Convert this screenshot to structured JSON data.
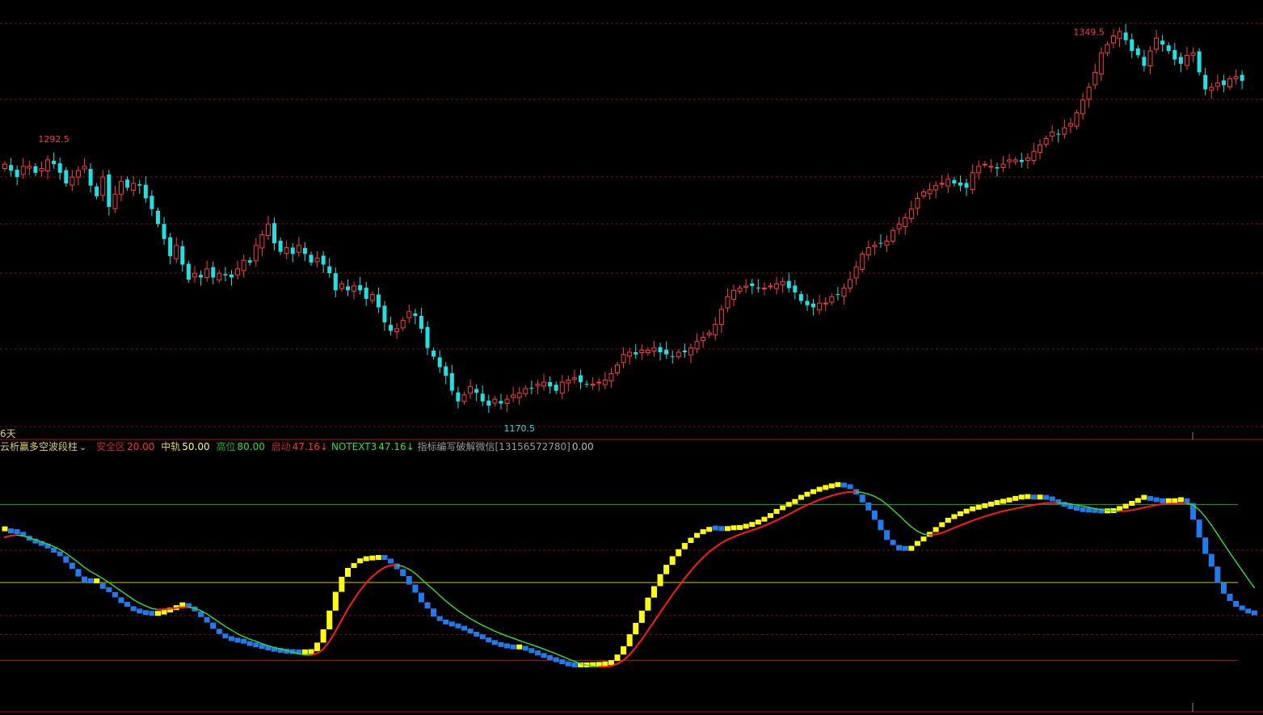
{
  "colors": {
    "background": "#000000",
    "up": "#ff3b3b",
    "down": "#19e3e3",
    "grid": "#7a1010",
    "bar_up": "#ffff00",
    "bar_down": "#1e7cf0",
    "line_red": "#ff1a1a",
    "line_green": "#2ee02e",
    "level_high": "#1fa61f",
    "level_mid": "#c8c81e",
    "level_low": "#b01e1e"
  },
  "period_label": "6天",
  "indicator": {
    "name": "云析赢多空波段柱",
    "chevron_icon": "chevron-down-icon",
    "safe_label": "安全区",
    "safe_value": "20.00",
    "mid_label": "中轨",
    "mid_value": "50.00",
    "high_label": "高位",
    "high_value": "80.00",
    "start_label": "启动",
    "start_value": "47.16↓",
    "notext_label": "NOTEXT3",
    "notext_value": "47.16↓",
    "watermark": "指标编写破解微信[13156572780]",
    "last_value": "0.00"
  },
  "chart_data": [
    {
      "type": "candlestick",
      "title": "",
      "annotations": [
        {
          "text": "1349.5",
          "kind": "high",
          "bar": 177
        },
        {
          "text": "1292.5",
          "kind": "local-high",
          "bar": 8
        },
        {
          "text": "1170.5",
          "kind": "low",
          "bar": 84
        }
      ],
      "ylim": [
        1168,
        1354
      ],
      "closes": [
        1287,
        1284,
        1281,
        1286,
        1286,
        1283,
        1285,
        1289,
        1287,
        1283,
        1278,
        1281,
        1284,
        1286,
        1277,
        1272,
        1281,
        1267,
        1273,
        1279,
        1276,
        1278,
        1277,
        1271,
        1266,
        1259,
        1252,
        1244,
        1249,
        1240,
        1233,
        1236,
        1234,
        1238,
        1234,
        1236,
        1235,
        1234,
        1238,
        1242,
        1241,
        1249,
        1254,
        1259,
        1250,
        1246,
        1248,
        1245,
        1249,
        1245,
        1241,
        1243,
        1240,
        1236,
        1228,
        1231,
        1228,
        1230,
        1228,
        1224,
        1226,
        1220,
        1213,
        1209,
        1210,
        1214,
        1218,
        1216,
        1210,
        1201,
        1197,
        1192,
        1188,
        1181,
        1176,
        1179,
        1183,
        1180,
        1176,
        1174,
        1177,
        1175,
        1177,
        1179,
        1180,
        1182,
        1182,
        1184,
        1185,
        1183,
        1181,
        1185,
        1186,
        1187,
        1185,
        1184,
        1184,
        1185,
        1186,
        1189,
        1193,
        1198,
        1199,
        1198,
        1200,
        1200,
        1201,
        1199,
        1198,
        1197,
        1199,
        1199,
        1201,
        1204,
        1206,
        1208,
        1212,
        1219,
        1225,
        1228,
        1229,
        1230,
        1230,
        1229,
        1229,
        1230,
        1231,
        1232,
        1229,
        1227,
        1223,
        1221,
        1220,
        1222,
        1222,
        1225,
        1226,
        1229,
        1233,
        1239,
        1245,
        1248,
        1249,
        1250,
        1251,
        1256,
        1259,
        1262,
        1266,
        1271,
        1274,
        1275,
        1277,
        1278,
        1280,
        1278,
        1277,
        1276,
        1283,
        1286,
        1287,
        1286,
        1285,
        1287,
        1289,
        1289,
        1288,
        1290,
        1293,
        1296,
        1299,
        1302,
        1301,
        1304,
        1306,
        1311,
        1317,
        1323,
        1330,
        1339,
        1343,
        1347,
        1349,
        1345,
        1340,
        1338,
        1333,
        1340,
        1346,
        1343,
        1340,
        1336,
        1334,
        1338,
        1339,
        1330,
        1322,
        1323,
        1325,
        1324,
        1327,
        1328,
        1326
      ]
    },
    {
      "type": "bar",
      "subtype": "oscillator",
      "ylim": [
        0,
        100
      ],
      "levels": [
        {
          "label": "安全区",
          "value": 20
        },
        {
          "label": "中轨",
          "value": 50
        },
        {
          "label": "高位",
          "value": 80
        }
      ],
      "series": [
        {
          "values": [
            69.7,
            68.9,
            68.6,
            67.6,
            66.1,
            65.0,
            64.1,
            63.1,
            61.5,
            60.1,
            57.6,
            55.2,
            52.3,
            50.0,
            49.7,
            49.7,
            47.6,
            46.3,
            44.3,
            42.1,
            40.7,
            39.0,
            38.1,
            37.5,
            37.2,
            37.7,
            38.5,
            39.4,
            40.5,
            40.9,
            40.2,
            38.9,
            36.7,
            34.6,
            32.2,
            30.2,
            28.5,
            27.5,
            26.9,
            26.5,
            25.6,
            25.1,
            24.5,
            23.9,
            23.4,
            23.0,
            22.7,
            22.5,
            22.4,
            22.5,
            23.6,
            26.9,
            32.0,
            39.2,
            46.4,
            52.2,
            55.6,
            57.4,
            58.2,
            58.5,
            58.7,
            59.0,
            58.7,
            57.3,
            55.1,
            52.5,
            49.2,
            46.1,
            42.4,
            40.0,
            36.9,
            35.2,
            33.9,
            33.1,
            32.4,
            31.5,
            30.4,
            29.2,
            28.2,
            27.0,
            26.0,
            25.2,
            24.7,
            24.3,
            24.3,
            23.8,
            22.9,
            22.0,
            21.0,
            20.2,
            19.4,
            18.6,
            17.8,
            17.4,
            17.4,
            17.5,
            17.6,
            17.8,
            18.3,
            19.9,
            22.3,
            25.5,
            30.1,
            34.5,
            39.2,
            44.2,
            48.6,
            53.2,
            56.8,
            60.1,
            62.8,
            65.2,
            67.2,
            68.6,
            69.5,
            70.1,
            70.0,
            69.8,
            70.1,
            70.2,
            70.7,
            71.4,
            72.3,
            73.4,
            74.8,
            76.4,
            77.8,
            79.1,
            80.2,
            81.8,
            83.0,
            84.0,
            84.9,
            85.6,
            86.2,
            86.7,
            86.8,
            86.5,
            85.9,
            83.8,
            80.8,
            77.7,
            74.1,
            70.1,
            66.4,
            64.4,
            62.3,
            62.2,
            64.1,
            65.8,
            67.6,
            69.4,
            71.3,
            73.0,
            74.4,
            75.5,
            76.5,
            77.4,
            78.0,
            78.6,
            79.2,
            79.8,
            80.3,
            80.8,
            81.4,
            81.9,
            82.1,
            82.2,
            81.9,
            81.9,
            81.8,
            81.2,
            80.1,
            79.1,
            78.2,
            77.6,
            77.1,
            76.9,
            76.8,
            76.6,
            76.7,
            77.5,
            78.4,
            79.5,
            80.6,
            81.8,
            81.9,
            81.4,
            80.9,
            80.5,
            80.5,
            80.9,
            81.1,
            80.5,
            74.2,
            67.3,
            61.0,
            56.1,
            49.9,
            45.7,
            42.9,
            40.7,
            39.3,
            38.1,
            37.4
          ]
        },
        {
          "values": [
            67.4,
            68.0,
            68.2,
            67.9,
            67.2,
            66.4,
            65.6,
            64.8,
            63.8,
            62.7,
            61.2,
            59.5,
            57.7,
            55.8,
            54.2,
            52.9,
            51.5,
            50.0,
            48.3,
            46.7,
            45.1,
            43.4,
            42.1,
            41.0,
            40.0,
            39.6,
            39.7,
            39.9,
            40.2,
            40.4,
            40.5,
            40.1,
            39.2,
            37.9,
            36.3,
            34.7,
            33.1,
            31.7,
            30.3,
            29.2,
            28.2,
            27.4,
            26.5,
            25.7,
            25.0,
            24.4,
            23.8,
            23.2,
            22.6,
            22.2,
            22.1,
            22.8,
            24.4,
            27.4,
            31.3,
            35.6,
            39.8,
            43.5,
            46.9,
            49.9,
            52.3,
            54.3,
            55.8,
            56.6,
            56.7,
            56.2,
            55.1,
            53.5,
            51.4,
            49.2,
            47.2,
            45.0,
            42.9,
            41.0,
            39.2,
            37.6,
            36.1,
            34.8,
            33.5,
            32.4,
            31.3,
            30.3,
            29.4,
            28.6,
            27.7,
            26.9,
            26.1,
            25.3,
            24.4,
            23.5,
            22.6,
            21.6,
            20.6,
            19.7,
            18.8,
            18.2,
            17.8,
            17.6,
            17.6,
            17.9,
            18.7,
            20.1,
            22.3,
            25.0,
            28.1,
            31.5,
            35.0,
            38.5,
            41.9,
            45.3,
            48.5,
            51.6,
            54.5,
            57.2,
            59.6,
            61.8,
            63.6,
            65.2,
            66.5,
            67.5,
            68.5,
            69.3,
            70.1,
            70.9,
            71.8,
            72.8,
            73.9,
            75.0,
            76.2,
            77.5,
            78.7,
            79.8,
            80.8,
            81.8,
            82.6,
            83.4,
            84.0,
            84.5,
            84.8,
            84.8,
            84.6,
            84.0,
            83.1,
            81.8,
            80.0,
            77.9,
            75.8,
            73.5,
            71.4,
            69.7,
            68.6,
            68.3,
            68.5,
            69.1,
            70.0,
            71.0,
            72.0,
            72.9,
            73.8,
            74.6,
            75.4,
            76.1,
            76.8,
            77.4,
            77.9,
            78.4,
            78.9,
            79.4,
            79.8,
            80.2,
            80.5,
            80.6,
            80.6,
            80.5,
            80.2,
            79.8,
            79.4,
            78.9,
            78.4,
            78.0,
            77.7,
            77.5,
            77.4,
            77.5,
            77.8,
            78.3,
            78.8,
            79.3,
            79.8,
            80.1,
            80.3,
            80.3,
            80.4,
            80.4,
            79.8,
            77.9,
            75.2,
            72.0,
            68.5,
            64.9,
            61.4,
            58.0,
            54.6,
            51.2,
            48.0
          ]
        }
      ]
    }
  ]
}
